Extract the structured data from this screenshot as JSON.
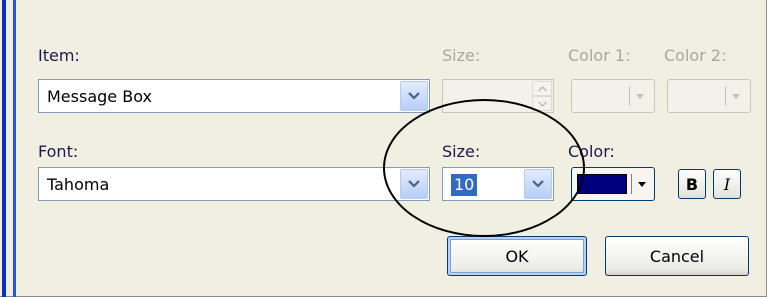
{
  "labels": {
    "item": "Item:",
    "size_top": "Size:",
    "color1": "Color 1:",
    "color2": "Color 2:",
    "font": "Font:",
    "size": "Size:",
    "color": "Color:"
  },
  "fields": {
    "item_value": "Message Box",
    "font_value": "Tahoma",
    "size_value": "10",
    "size_top_value": ""
  },
  "style_buttons": {
    "bold": "B",
    "italic": "I"
  },
  "buttons": {
    "ok": "OK",
    "cancel": "Cancel"
  },
  "colors": {
    "selected_font_color": "#00007e",
    "selection_highlight": "#316ac5"
  },
  "icons": [
    "chevron-down-icon",
    "spin-up-icon",
    "spin-down-icon",
    "dropdown-arrow-icon"
  ]
}
